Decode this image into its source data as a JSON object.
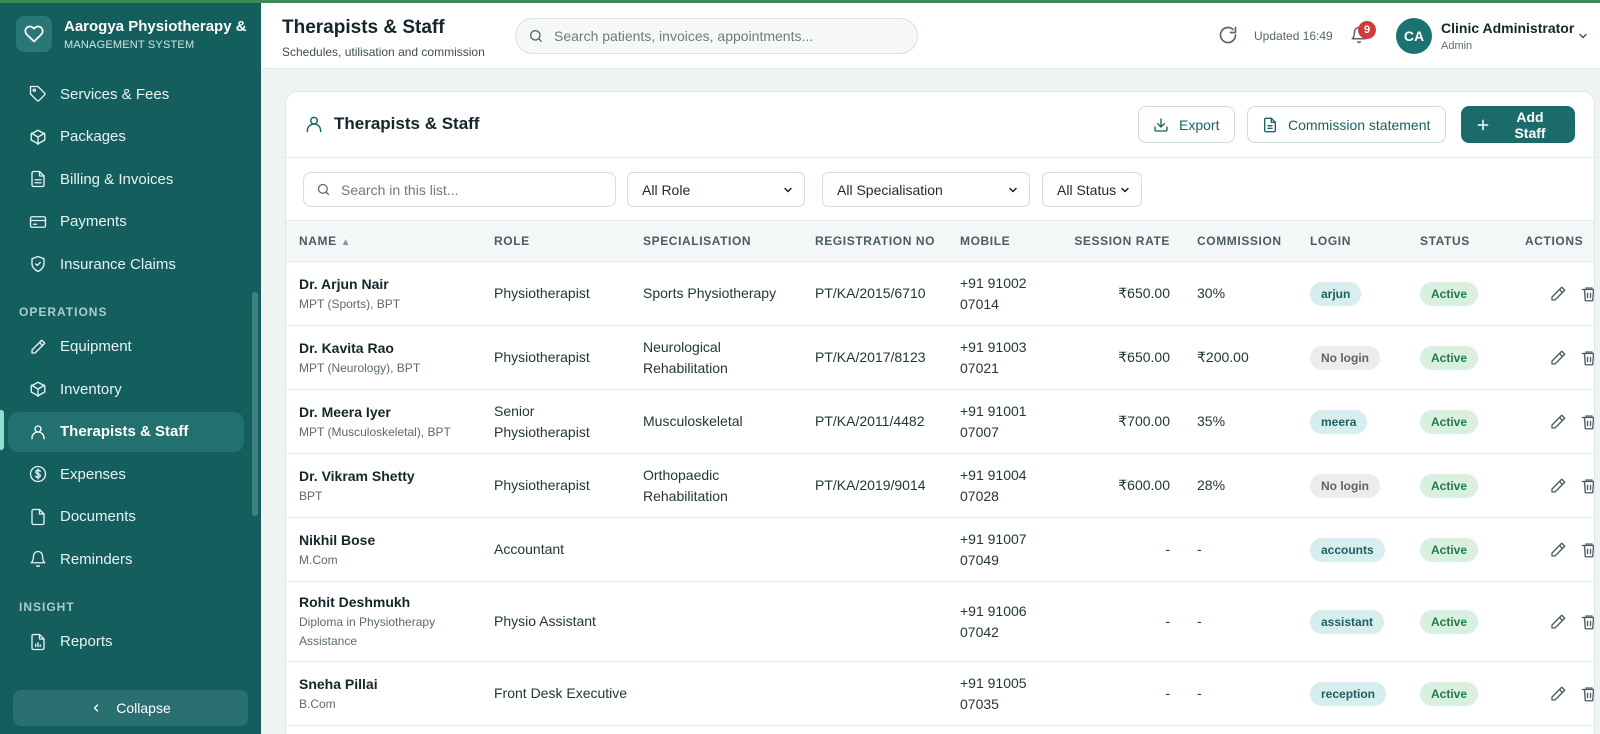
{
  "app": {
    "name": "Aarogya Physiotherapy & Rehabilitation",
    "subtitle": "MANAGEMENT SYSTEM"
  },
  "sidebar": {
    "items_top": [
      {
        "label": "Services & Fees",
        "icon": "tag-icon"
      },
      {
        "label": "Packages",
        "icon": "box-icon"
      },
      {
        "label": "Billing & Invoices",
        "icon": "file-icon"
      },
      {
        "label": "Payments",
        "icon": "card-icon"
      },
      {
        "label": "Insurance Claims",
        "icon": "shield-icon"
      }
    ],
    "section_operations": "OPERATIONS",
    "items_ops": [
      {
        "label": "Equipment",
        "icon": "wrench-icon"
      },
      {
        "label": "Inventory",
        "icon": "box-icon"
      },
      {
        "label": "Therapists & Staff",
        "icon": "user-icon",
        "active": true
      },
      {
        "label": "Expenses",
        "icon": "dollar-icon"
      },
      {
        "label": "Documents",
        "icon": "document-icon"
      },
      {
        "label": "Reminders",
        "icon": "bell-icon"
      }
    ],
    "section_insight": "INSIGHT",
    "items_insight": [
      {
        "label": "Reports",
        "icon": "report-icon"
      }
    ],
    "collapse_label": "Collapse"
  },
  "header": {
    "title": "Therapists & Staff",
    "subtitle": "Schedules, utilisation and commission",
    "search_placeholder": "Search patients, invoices, appointments...",
    "updated": "Updated 16:49",
    "notifications": "9",
    "avatar_initials": "CA",
    "user_name": "Clinic Administrator",
    "user_role": "Admin"
  },
  "card": {
    "title": "Therapists & Staff",
    "export_label": "Export",
    "commission_label": "Commission statement",
    "add_label": "Add Staff",
    "list_search_placeholder": "Search in this list...",
    "filter_role": "All Role",
    "filter_spec": "All Specialisation",
    "filter_status": "All Status"
  },
  "table": {
    "columns": [
      "NAME",
      "ROLE",
      "SPECIALISATION",
      "REGISTRATION NO",
      "MOBILE",
      "SESSION RATE",
      "COMMISSION",
      "LOGIN",
      "STATUS",
      "ACTIONS"
    ],
    "rows": [
      {
        "name": "Dr. Arjun Nair",
        "qual": "MPT (Sports), BPT",
        "role": "Physiotherapist",
        "spec": "Sports Physiotherapy",
        "reg": "PT/KA/2015/6710",
        "mobile": "+91 91002 07014",
        "rate": "₹650.00",
        "commission": "30%",
        "login": "arjun",
        "has_login": true,
        "status": "Active"
      },
      {
        "name": "Dr. Kavita Rao",
        "qual": "MPT (Neurology), BPT",
        "role": "Physiotherapist",
        "spec": "Neurological Rehabilitation",
        "reg": "PT/KA/2017/8123",
        "mobile": "+91 91003 07021",
        "rate": "₹650.00",
        "commission": "₹200.00",
        "login": "No login",
        "has_login": false,
        "status": "Active"
      },
      {
        "name": "Dr. Meera Iyer",
        "qual": "MPT (Musculoskeletal), BPT",
        "role": "Senior Physiotherapist",
        "spec": "Musculoskeletal",
        "reg": "PT/KA/2011/4482",
        "mobile": "+91 91001 07007",
        "rate": "₹700.00",
        "commission": "35%",
        "login": "meera",
        "has_login": true,
        "status": "Active"
      },
      {
        "name": "Dr. Vikram Shetty",
        "qual": "BPT",
        "role": "Physiotherapist",
        "spec": "Orthopaedic Rehabilitation",
        "reg": "PT/KA/2019/9014",
        "mobile": "+91 91004 07028",
        "rate": "₹600.00",
        "commission": "28%",
        "login": "No login",
        "has_login": false,
        "status": "Active"
      },
      {
        "name": "Nikhil Bose",
        "qual": "M.Com",
        "role": "Accountant",
        "spec": "",
        "reg": "",
        "mobile": "+91 91007 07049",
        "rate": "-",
        "commission": "-",
        "login": "accounts",
        "has_login": true,
        "status": "Active"
      },
      {
        "name": "Rohit Deshmukh",
        "qual": "Diploma in Physiotherapy Assistance",
        "role": "Physio Assistant",
        "spec": "",
        "reg": "",
        "mobile": "+91 91006 07042",
        "rate": "-",
        "commission": "-",
        "login": "assistant",
        "has_login": true,
        "status": "Active"
      },
      {
        "name": "Sneha Pillai",
        "qual": "B.Com",
        "role": "Front Desk Executive",
        "spec": "",
        "reg": "",
        "mobile": "+91 91005 07035",
        "rate": "-",
        "commission": "-",
        "login": "reception",
        "has_login": true,
        "status": "Active"
      }
    ]
  },
  "colors": {
    "sidebar": "#155e5e",
    "accent": "#1b6b6b",
    "active_status": "#1f7a44",
    "badge": "#d23b3b"
  }
}
